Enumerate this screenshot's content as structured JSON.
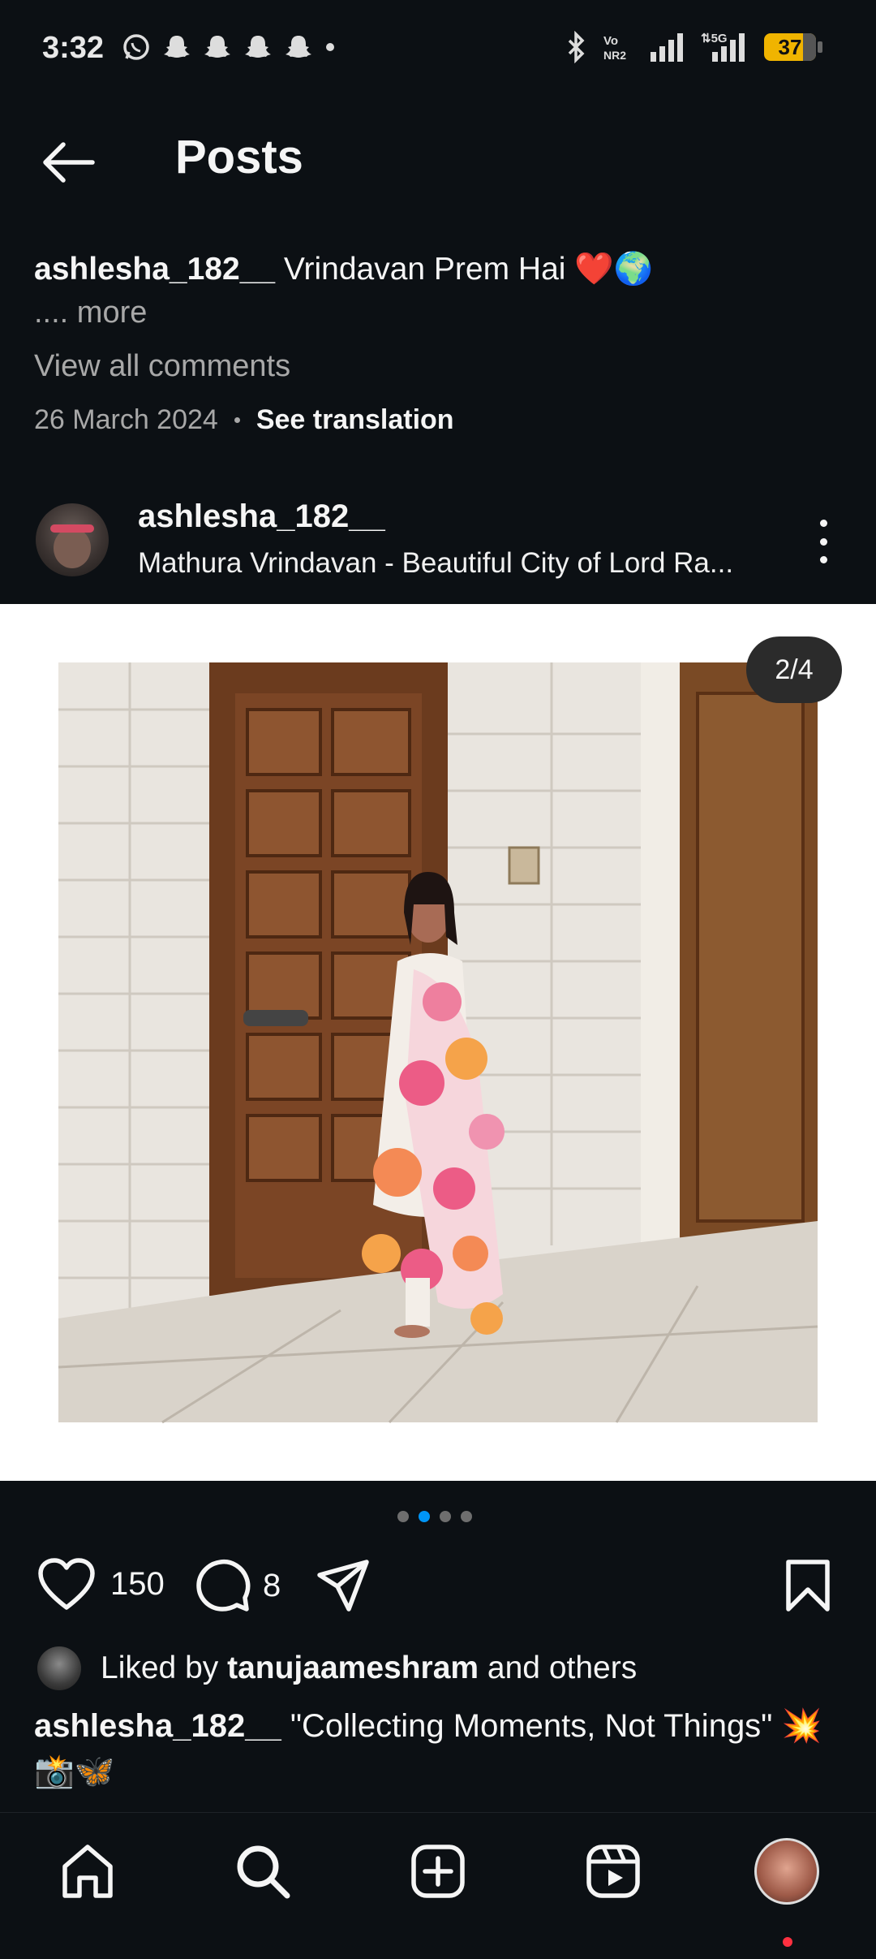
{
  "status_bar": {
    "time": "3:32",
    "battery": "37",
    "network": "5G",
    "volte": "Vo\nNR2"
  },
  "header": {
    "title": "Posts"
  },
  "previous_post": {
    "username": "ashlesha_182__",
    "caption": "Vrindavan Prem Hai ❤️🌍",
    "more": ".... more",
    "view_all_comments": "View all comments",
    "date": "26 March 2024",
    "see_translation": "See translation"
  },
  "post": {
    "username": "ashlesha_182__",
    "location": "Mathura Vrindavan - Beautiful City of Lord Ra...",
    "media_counter": "2/4",
    "carousel_total": 4,
    "carousel_active_index": 1,
    "likes_count": "150",
    "comments_count": "8",
    "liked_by_prefix": "Liked by",
    "liked_by_user": "tanujaameshram",
    "liked_by_suffix": "and others",
    "caption_username": "ashlesha_182__",
    "caption": "\"Collecting Moments, Not Things\" 💥📸🦋"
  },
  "icons": {
    "back": "arrow-left-icon",
    "more": "kebab-menu-icon",
    "like": "heart-outline-icon",
    "comment": "comment-bubble-icon",
    "share": "send-icon",
    "save": "bookmark-icon",
    "nav": [
      "home-icon",
      "search-icon",
      "create-icon",
      "reels-icon",
      "profile-avatar"
    ]
  },
  "colors": {
    "background": "#0c1014",
    "text": "#f5f5f5",
    "muted": "#a8a8a8",
    "accent": "#0095f6",
    "notification": "#ff3040",
    "battery": "#f0b400"
  }
}
